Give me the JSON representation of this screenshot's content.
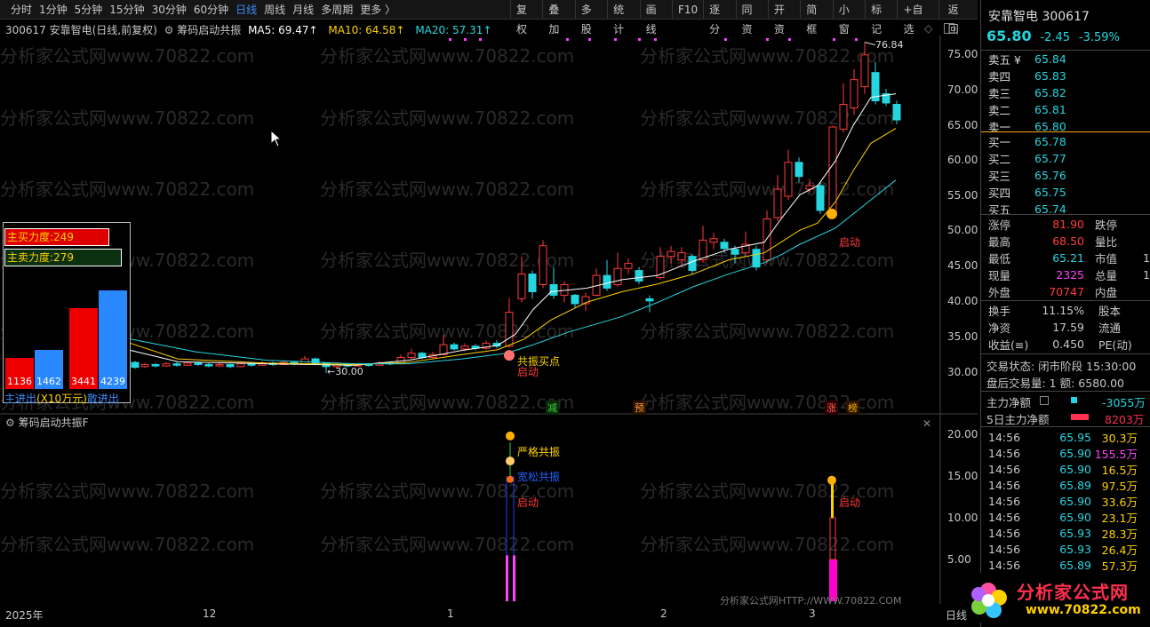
{
  "periods": [
    "分时",
    "1分钟",
    "5分钟",
    "15分钟",
    "30分钟",
    "60分钟",
    "日线",
    "周线",
    "月线",
    "多周期",
    "更多 〉"
  ],
  "active_period": "日线",
  "toolbar": [
    "复权",
    "叠加",
    "多股",
    "统计",
    "画线",
    "F10",
    "逐分",
    "同资",
    "开资",
    "简框",
    "小窗",
    "标记",
    "+自选",
    "返回"
  ],
  "chart_title": "300617 安靠智电(日线,前复权)",
  "indicator_name": "筹码启动共振",
  "ma": {
    "ma5": "MA5: 69.47↑",
    "ma10": "MA10: 64.58↑",
    "ma20": "MA20: 57.31↑"
  },
  "y_ticks": [
    "75.00",
    "70.00",
    "65.00",
    "60.00",
    "55.00",
    "50.00",
    "45.00",
    "40.00",
    "35.00",
    "30.00"
  ],
  "y_ticks_lower": [
    "20.00",
    "15.00",
    "10.00",
    "5.00"
  ],
  "x_ticks": [
    "2025年",
    "12",
    "1",
    "2",
    "3",
    "日线"
  ],
  "high_label": "76.84",
  "low_label": "←30.00",
  "watermark": "分析家公式网www.70822.com",
  "markers": {
    "buy_point": "共振买点",
    "start1": "启动",
    "start2": "启动",
    "strict": "严格共振",
    "loose": "宽松共振",
    "start3": "启动",
    "start4": "启动",
    "reduce": "减",
    "pre": "预",
    "zhang": "涨",
    "bang": "榜"
  },
  "flow_panel": {
    "buy": "主买力度:249",
    "sell": "主卖力度:279",
    "bars": [
      "1136",
      "1462",
      "3441",
      "4239"
    ],
    "footer_in": "主进出",
    "footer_unit": "(X10万元)",
    "footer_out": "散进出"
  },
  "lower_title": "筹码启动共振F",
  "footer_site": "分析家公式网HTTP://WWW.70822.COM",
  "stock": {
    "name": "安靠智电",
    "code": "300617",
    "price": "65.80",
    "change": "-2.45",
    "pct": "-3.59%"
  },
  "sell_orders": [
    {
      "l": "卖五 ¥",
      "p": "65.84"
    },
    {
      "l": "卖四",
      "p": "65.83"
    },
    {
      "l": "卖三",
      "p": "65.82"
    },
    {
      "l": "卖二",
      "p": "65.81"
    },
    {
      "l": "卖一",
      "p": "65.80"
    }
  ],
  "buy_orders": [
    {
      "l": "买一",
      "p": "65.78"
    },
    {
      "l": "买二",
      "p": "65.77"
    },
    {
      "l": "买三",
      "p": "65.76"
    },
    {
      "l": "买四",
      "p": "65.75"
    },
    {
      "l": "买五",
      "p": "65.74"
    }
  ],
  "stats": [
    [
      "涨停",
      "81.90",
      "跌停",
      ""
    ],
    [
      "最高",
      "68.50",
      "量比",
      ""
    ],
    [
      "最低",
      "65.21",
      "市值",
      "1"
    ],
    [
      "现量",
      "2325",
      "总量",
      "1"
    ],
    [
      "外盘",
      "70747",
      "内盘",
      ""
    ]
  ],
  "stats2": [
    [
      "换手",
      "11.15%",
      "股本"
    ],
    [
      "净资",
      "17.59",
      "流通"
    ],
    [
      "收益(≡)",
      "0.450",
      "PE(动)"
    ]
  ],
  "trade_state": "交易状态: 闭市阶段 15:30:00",
  "after_hours": "盘后交易量: 1  额: 6580.00",
  "main_net": {
    "label": "主力净额",
    "value": "-3055万"
  },
  "main_net5": {
    "label": "5日主力净额",
    "value": "8203万"
  },
  "ticks": [
    [
      "14:56",
      "65.95",
      "30.3万"
    ],
    [
      "14:56",
      "65.90",
      "155.5万"
    ],
    [
      "14:56",
      "65.90",
      "16.5万"
    ],
    [
      "14:56",
      "65.89",
      "97.5万"
    ],
    [
      "14:56",
      "65.90",
      "33.6万"
    ],
    [
      "14:56",
      "65.90",
      "23.1万"
    ],
    [
      "14:56",
      "65.93",
      "28.3万"
    ],
    [
      "14:56",
      "65.93",
      "26.4万"
    ],
    [
      "14:56",
      "65.89",
      "57.3万"
    ]
  ],
  "logo_text": "分析家公式网",
  "logo_url": "www.70822.com"
}
